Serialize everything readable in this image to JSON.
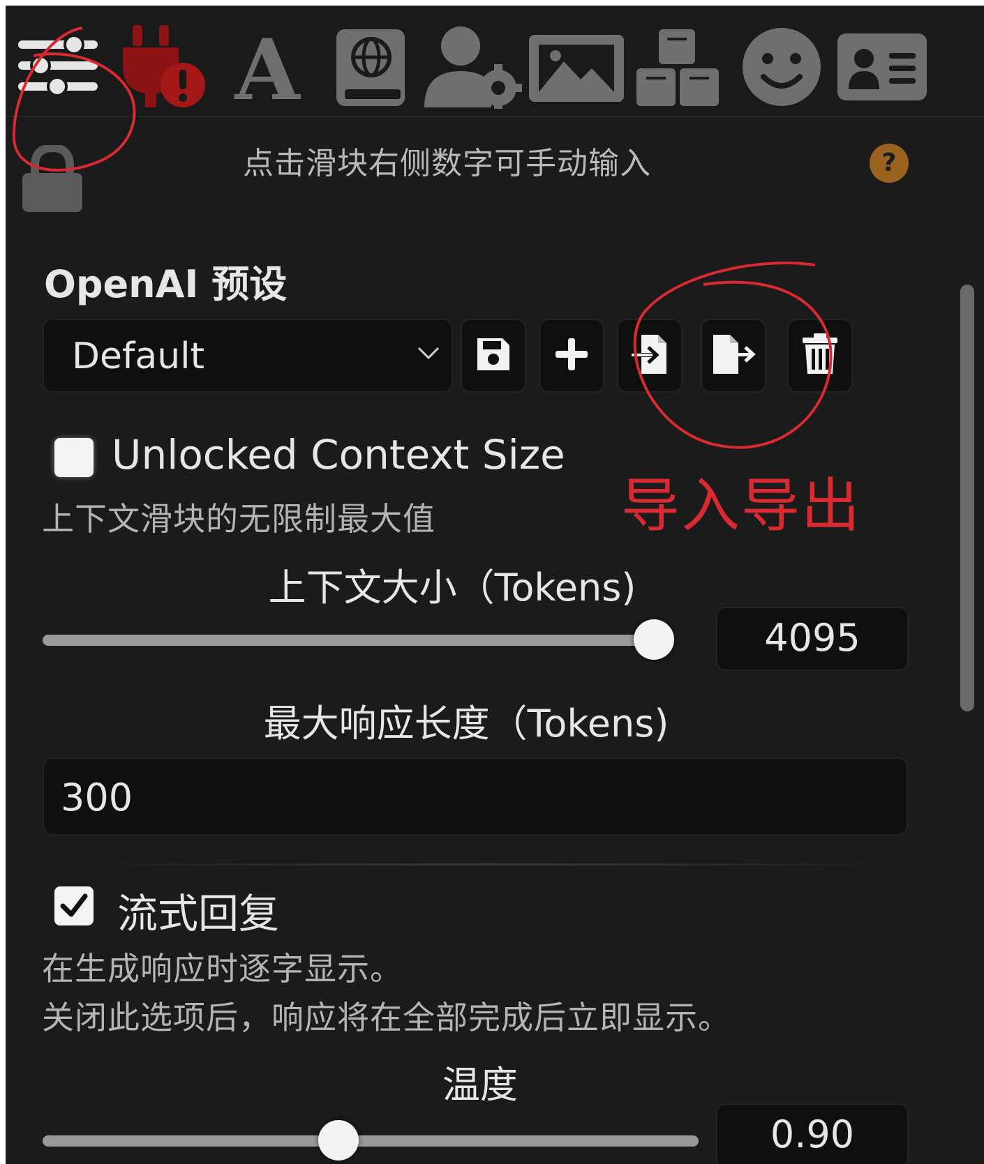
{
  "toolbar": {
    "tabs": [
      {
        "icon": "sliders-icon"
      },
      {
        "icon": "plug-warning-icon"
      },
      {
        "icon": "font-a-icon"
      },
      {
        "icon": "world-book-icon"
      },
      {
        "icon": "user-settings-icon"
      },
      {
        "icon": "image-icon"
      },
      {
        "icon": "cubes-icon"
      },
      {
        "icon": "smiley-icon"
      },
      {
        "icon": "id-card-icon"
      }
    ]
  },
  "panel": {
    "lock_icon": "lock-icon",
    "hint_text": "点击滑块右侧数字可手动输入",
    "help_label": "?"
  },
  "preset": {
    "section_title": "OpenAI 预设",
    "selected": "Default",
    "buttons": [
      {
        "icon": "save-icon"
      },
      {
        "icon": "plus-icon"
      },
      {
        "icon": "file-import-icon"
      },
      {
        "icon": "file-export-icon"
      },
      {
        "icon": "trash-icon"
      }
    ]
  },
  "unlocked_context": {
    "label": "Unlocked Context Size",
    "description": "上下文滑块的无限制最大值",
    "checked": false
  },
  "annotation": {
    "text": "导入导出",
    "color": "#d82a30"
  },
  "context_size": {
    "label": "上下文大小（Tokens)",
    "value": "4095",
    "slider_fraction": 1.0
  },
  "max_response": {
    "label": "最大响应长度（Tokens)",
    "value": "300"
  },
  "streaming": {
    "label": "流式回复",
    "description_line1": "在生成响应时逐字显示。",
    "description_line2": "关闭此选项后，响应将在全部完成后立即显示。",
    "checked": true
  },
  "temperature": {
    "label": "温度",
    "value": "0.90",
    "slider_fraction": 0.45
  }
}
